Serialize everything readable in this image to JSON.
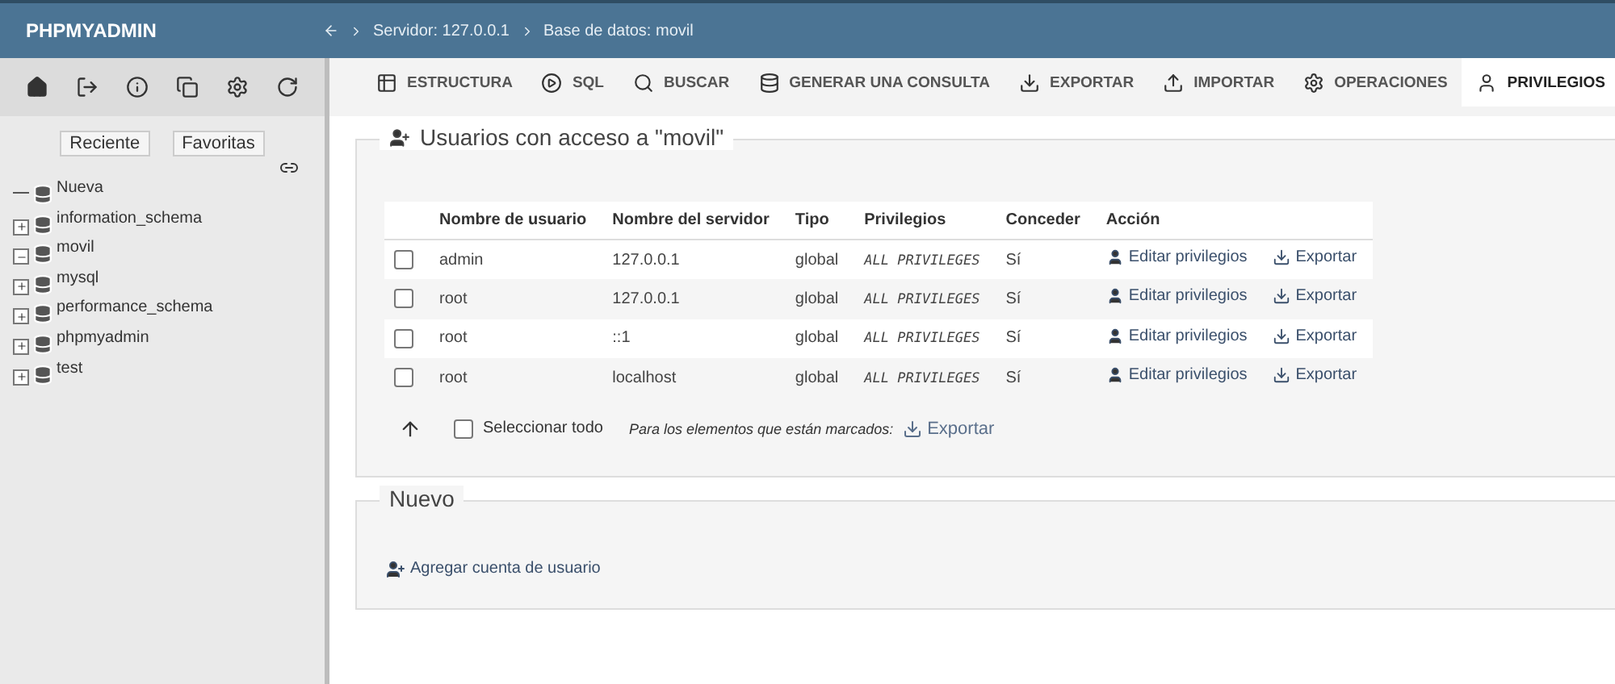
{
  "header": {
    "title": "PHPMYADMIN",
    "breadcrumbs": [
      "Servidor: 127.0.0.1",
      "Base de datos: movil"
    ]
  },
  "sidebar": {
    "buttons": [
      "Reciente",
      "Favoritas"
    ],
    "tree": [
      {
        "kind": "new",
        "label": "Nueva"
      },
      {
        "kind": "db",
        "label": "information_schema",
        "expanded": false
      },
      {
        "kind": "db",
        "label": "movil",
        "expanded": true
      },
      {
        "kind": "db",
        "label": "mysql",
        "expanded": false
      },
      {
        "kind": "db",
        "label": "performance_schema",
        "expanded": false
      },
      {
        "kind": "db",
        "label": "phpmyadmin",
        "expanded": false
      },
      {
        "kind": "db",
        "label": "test",
        "expanded": false
      }
    ]
  },
  "tabs": [
    {
      "label": "ESTRUCTURA",
      "selected": false
    },
    {
      "label": "SQL",
      "selected": false
    },
    {
      "label": "BUSCAR",
      "selected": false
    },
    {
      "label": "GENERAR UNA CONSULTA",
      "selected": false
    },
    {
      "label": "EXPORTAR",
      "selected": false
    },
    {
      "label": "IMPORTAR",
      "selected": false
    },
    {
      "label": "OPERACIONES",
      "selected": false
    },
    {
      "label": "PRIVILEGIOS",
      "selected": true
    }
  ],
  "users_section": {
    "legend": "Usuarios con acceso a \"movil\"",
    "columns": [
      "Nombre de usuario",
      "Nombre del servidor",
      "Tipo",
      "Privilegios",
      "Conceder",
      "Acción"
    ],
    "rows": [
      {
        "checked": false,
        "user": "admin",
        "host": "127.0.0.1",
        "type": "global",
        "privileges": "ALL PRIVILEGES",
        "grant": "Sí",
        "edit": "Editar privilegios",
        "export": "Exportar"
      },
      {
        "checked": false,
        "user": "root",
        "host": "127.0.0.1",
        "type": "global",
        "privileges": "ALL PRIVILEGES",
        "grant": "Sí",
        "edit": "Editar privilegios",
        "export": "Exportar"
      },
      {
        "checked": false,
        "user": "root",
        "host": "::1",
        "type": "global",
        "privileges": "ALL PRIVILEGES",
        "grant": "Sí",
        "edit": "Editar privilegios",
        "export": "Exportar"
      },
      {
        "checked": false,
        "user": "root",
        "host": "localhost",
        "type": "global",
        "privileges": "ALL PRIVILEGES",
        "grant": "Sí",
        "edit": "Editar privilegios",
        "export": "Exportar"
      }
    ],
    "select_all": {
      "label": "Seleccionar todo",
      "checked": false
    },
    "with_selected": "Para los elementos que están marcados:",
    "bulk_export": "Exportar"
  },
  "new_section": {
    "legend": "Nuevo",
    "add_link": "Agregar cuenta de usuario"
  }
}
